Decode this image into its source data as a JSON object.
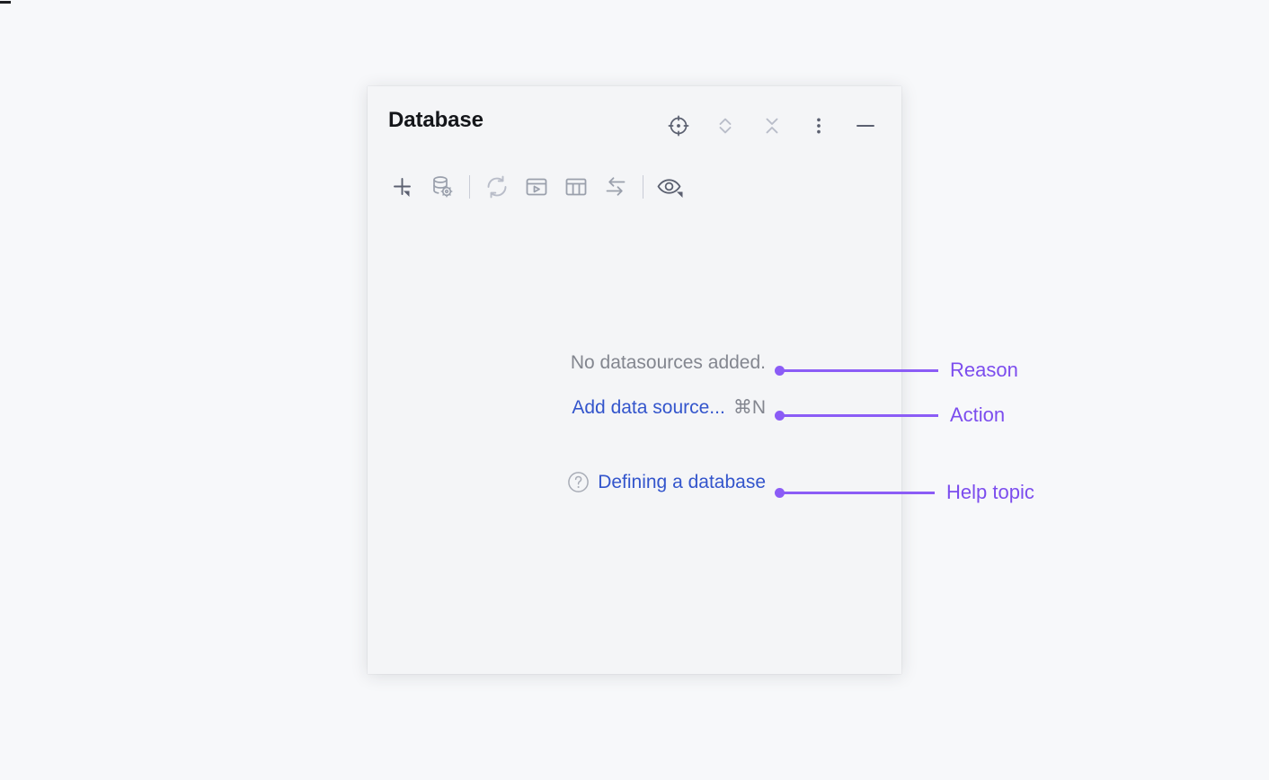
{
  "window": {
    "title": "Database",
    "header_actions": [
      {
        "name": "select-opened-file-icon",
        "label": "Select Opened File"
      },
      {
        "name": "expand-all-icon",
        "label": "Expand All"
      },
      {
        "name": "collapse-all-icon",
        "label": "Collapse All"
      },
      {
        "name": "more-options-icon",
        "label": "Options"
      },
      {
        "name": "minimize-icon",
        "label": "Hide"
      }
    ],
    "toolbar_items": [
      {
        "name": "add-icon",
        "label": "New",
        "has_dropdown": true
      },
      {
        "name": "database-settings-icon",
        "label": "Data Source Properties",
        "has_dropdown": false
      },
      {
        "name": "separator",
        "label": "",
        "has_dropdown": false
      },
      {
        "name": "refresh-icon",
        "label": "Refresh",
        "has_dropdown": false
      },
      {
        "name": "open-console-icon",
        "label": "Open Console",
        "has_dropdown": false
      },
      {
        "name": "table-editor-icon",
        "label": "Data Editor",
        "has_dropdown": false
      },
      {
        "name": "data-transfer-icon",
        "label": "Import/Export Data",
        "has_dropdown": false
      },
      {
        "name": "separator",
        "label": "",
        "has_dropdown": false
      },
      {
        "name": "eye-icon",
        "label": "Show/Hide Schemas",
        "has_dropdown": true
      }
    ]
  },
  "empty_state": {
    "reason_text": "No datasources added.",
    "action_text": "Add data source...",
    "action_shortcut": "⌘N",
    "help_icon": "question-mark-circle-icon",
    "help_text": "Defining a database"
  },
  "annotations": {
    "accent_color": "#8b5cf6",
    "label_color": "#7c4dee",
    "items": [
      {
        "label": "Reason"
      },
      {
        "label": "Action"
      },
      {
        "label": "Help topic"
      }
    ]
  },
  "colors": {
    "page_background": "#f7f8fa",
    "panel_background": "#f4f5f7",
    "title": "#14161a",
    "muted_text": "#83868f",
    "link": "#3355cc",
    "icon": "#9aa0ac"
  }
}
